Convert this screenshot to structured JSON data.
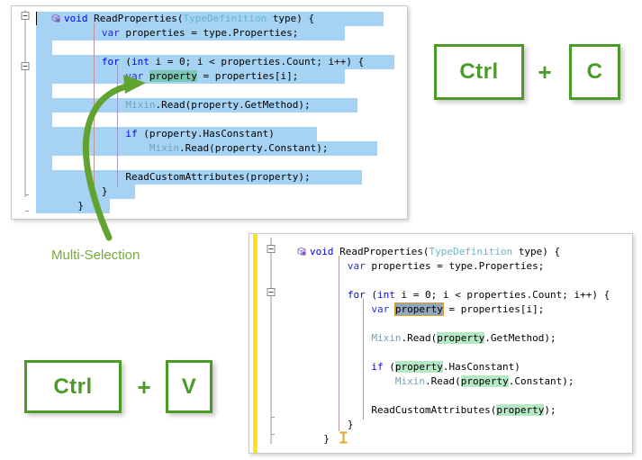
{
  "colors": {
    "selection": "#a6d2f4",
    "accent_green": "#4a9b28",
    "annotation_green": "#76ad3b",
    "highlight_green": "#b5e8c4",
    "highlight_teal": "#79c7b4",
    "rename_fill": "#8fa8bd",
    "rename_border": "#e09a2b",
    "changebar_yellow": "#ffe01a",
    "panel_border": "#c8c8c8",
    "keyword_blue": "#0000ff",
    "type_cyan": "#67b6c7"
  },
  "annotation": {
    "label": "Multi-Selection"
  },
  "shortcut_copy": {
    "modifier": "Ctrl",
    "plus": "+",
    "key": "C"
  },
  "shortcut_paste": {
    "modifier": "Ctrl",
    "plus": "+",
    "key": "V"
  },
  "top_editor": {
    "name": "code-editor-multiselect",
    "lines": [
      {
        "indent": 0,
        "text": "void ReadProperties(TypeDefinition type) {"
      },
      {
        "indent": 0,
        "text": "    var properties = type.Properties;"
      },
      {
        "indent": 0,
        "text": ""
      },
      {
        "indent": 0,
        "text": "    for (int i = 0; i < properties.Count; i++) {"
      },
      {
        "indent": 0,
        "text": "        var property = properties[i];"
      },
      {
        "indent": 0,
        "text": ""
      },
      {
        "indent": 0,
        "text": "        Mixin.Read(property.GetMethod);"
      },
      {
        "indent": 0,
        "text": ""
      },
      {
        "indent": 0,
        "text": "        if (property.HasConstant)"
      },
      {
        "indent": 0,
        "text": "            Mixin.Read(property.Constant);"
      },
      {
        "indent": 0,
        "text": ""
      },
      {
        "indent": 0,
        "text": "        ReadCustomAttributes(property);"
      },
      {
        "indent": 0,
        "text": "    }"
      },
      {
        "indent": 0,
        "text": "}"
      }
    ],
    "selected_token": "property"
  },
  "bottom_editor": {
    "name": "code-editor-renamed",
    "lines": [
      {
        "indent": 0,
        "text": "void ReadProperties(TypeDefinition type) {"
      },
      {
        "indent": 0,
        "text": "    var properties = type.Properties;"
      },
      {
        "indent": 0,
        "text": ""
      },
      {
        "indent": 0,
        "text": "    for (int i = 0; i < properties.Count; i++) {"
      },
      {
        "indent": 0,
        "text": "        var property = properties[i];"
      },
      {
        "indent": 0,
        "text": ""
      },
      {
        "indent": 0,
        "text": "        Mixin.Read(property.GetMethod);"
      },
      {
        "indent": 0,
        "text": ""
      },
      {
        "indent": 0,
        "text": "        if (property.HasConstant)"
      },
      {
        "indent": 0,
        "text": "            Mixin.Read(property.Constant);"
      },
      {
        "indent": 0,
        "text": ""
      },
      {
        "indent": 0,
        "text": "        ReadCustomAttributes(property);"
      },
      {
        "indent": 0,
        "text": "    }"
      },
      {
        "indent": 0,
        "text": "}"
      }
    ],
    "renamed_token": "property"
  },
  "tokens": {
    "kw_void": "void",
    "kw_var": "var",
    "kw_for": "for",
    "kw_int": "int",
    "kw_if": "if",
    "method_name": "ReadProperties",
    "type_name": "TypeDefinition",
    "param_name": "type",
    "properties_var": "properties",
    "mixin": "Mixin",
    "read": "Read",
    "get_method": "GetMethod",
    "has_constant": "HasConstant",
    "constant": "Constant",
    "read_custom_attributes": "ReadCustomAttributes",
    "count": "Count",
    "loop_var": "i",
    "property_token": "property"
  }
}
